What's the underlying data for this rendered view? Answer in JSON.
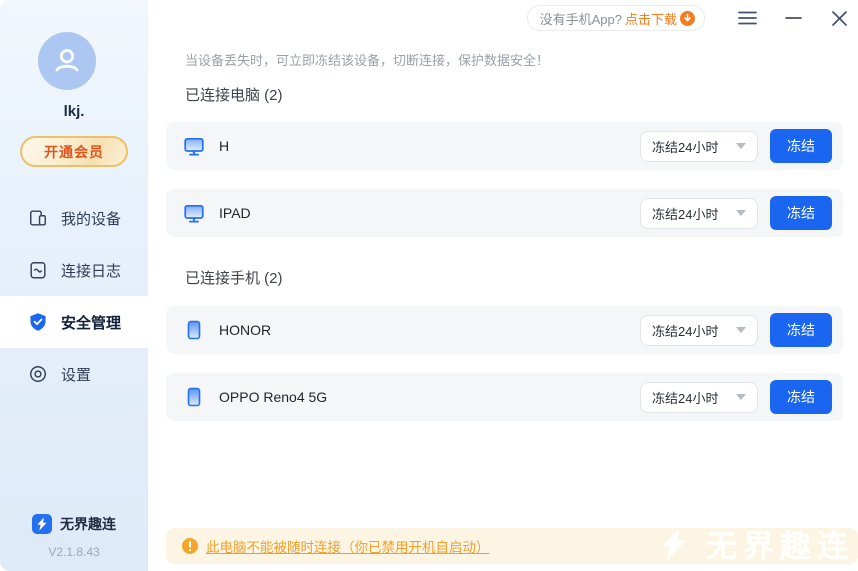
{
  "topbar": {
    "download_pill": {
      "text_gray": "没有手机App?",
      "text_orange": "点击下载"
    }
  },
  "sidebar": {
    "username": "lkj.",
    "vip_button_label": "开通会员",
    "items": [
      {
        "label": "我的设备",
        "icon": "devices-icon",
        "selected": false
      },
      {
        "label": "连接日志",
        "icon": "log-icon",
        "selected": false
      },
      {
        "label": "安全管理",
        "icon": "shield-check-icon",
        "selected": true
      },
      {
        "label": "设置",
        "icon": "settings-icon",
        "selected": false
      }
    ],
    "app_name": "无界趣连",
    "version": "V2.1.8.43"
  },
  "main": {
    "description": "当设备丢失时，可立即冻结该设备，切断连接，保护数据安全！",
    "sections": [
      {
        "title": "已连接电脑 (2)",
        "devices": [
          {
            "name": "H",
            "type": "computer"
          },
          {
            "name": "IPAD",
            "type": "computer"
          }
        ]
      },
      {
        "title": "已连接手机 (2)",
        "devices": [
          {
            "name": "HONOR",
            "type": "phone"
          },
          {
            "name": "OPPO Reno4 5G",
            "type": "phone"
          }
        ]
      }
    ],
    "freeze_dropdown_label": "冻结24小时",
    "freeze_button_label": "冻结",
    "warning_text": "此电脑不能被随时连接（你已禁用开机自启动）",
    "watermark_text": "无界趣连"
  },
  "colors": {
    "primary_blue": "#1b66f0",
    "accent_orange": "#f57c1f",
    "warning_text": "#f0a02f",
    "warning_bg": "#fdf5e3",
    "vip_text": "#df551d",
    "sidebar_bg": "#e7f0fb",
    "row_bg": "#f5f6f8"
  }
}
